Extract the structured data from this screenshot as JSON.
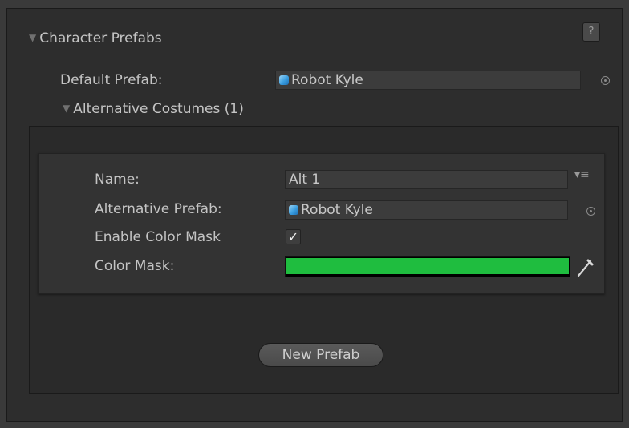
{
  "section": {
    "title": "Character Prefabs",
    "help_label": "?"
  },
  "default_prefab": {
    "label": "Default Prefab:",
    "value": "Robot Kyle"
  },
  "alternatives": {
    "label": "Alternative Costumes",
    "count": "(1)",
    "element": {
      "name_label": "Name:",
      "name_value": "Alt 1",
      "prefab_label": "Alternative Prefab:",
      "prefab_value": "Robot Kyle",
      "enable_mask_label": "Enable Color Mask",
      "enable_mask_checked": true,
      "color_mask_label": "Color Mask:",
      "color_mask_value": "#1fbd3f"
    },
    "new_button_label": "New Prefab"
  },
  "icons": {
    "foldout": "triangle-down-icon",
    "object": "prefab-cube-icon",
    "picker": "object-picker-icon",
    "menu": "element-menu-icon",
    "eyedropper": "eyedropper-icon",
    "help": "help-icon"
  }
}
